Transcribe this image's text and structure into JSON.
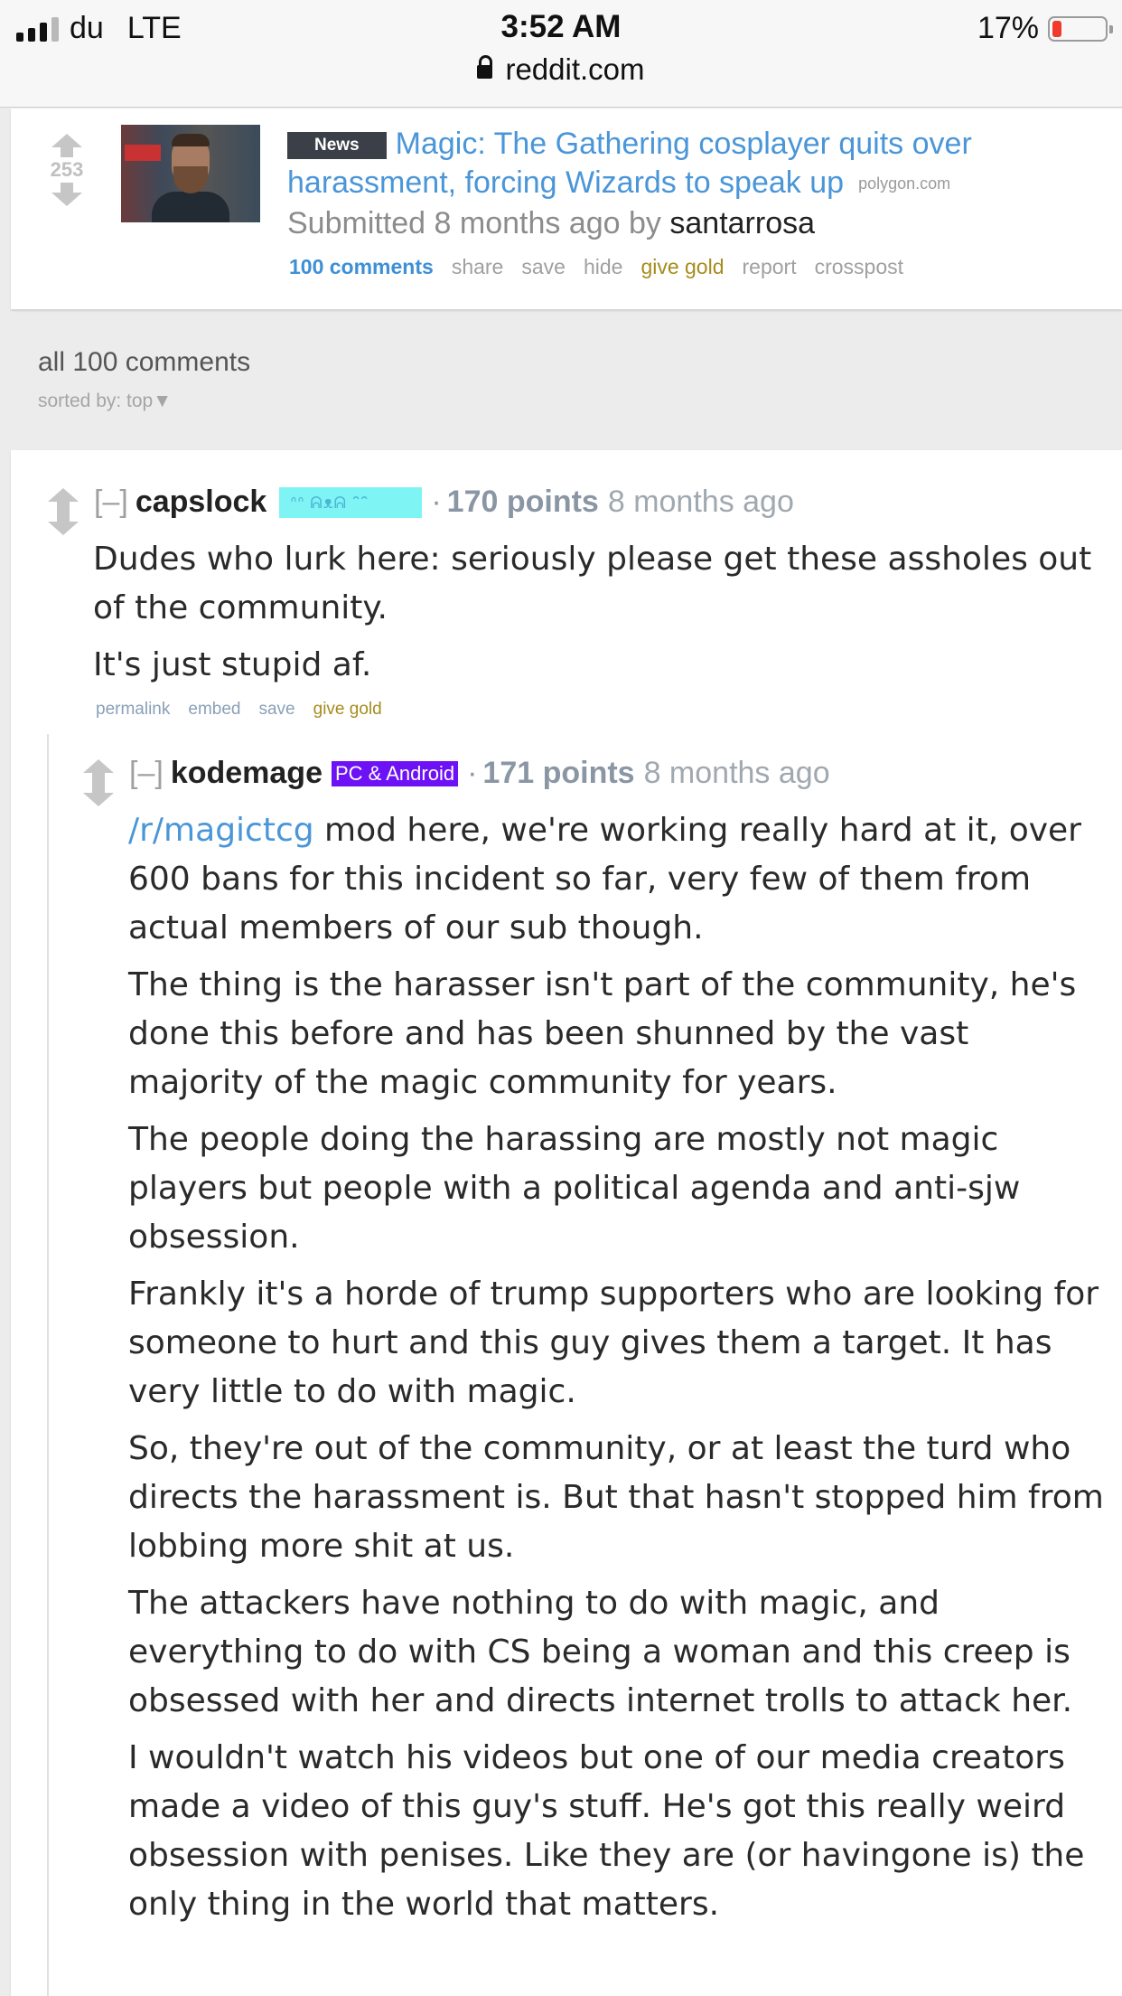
{
  "status_bar": {
    "carrier": "du",
    "network": "LTE",
    "time": "3:52 AM",
    "url": "reddit.com",
    "battery_percent": "17%",
    "battery_level": 0.17,
    "battery_color": "#f03a2e"
  },
  "post": {
    "score": "253",
    "flair": "News",
    "title": "Magic: The Gathering cosplayer quits over harassment, forcing Wizards to speak up",
    "domain": "polygon.com",
    "submitted_prefix": "Submitted 8 months ago by",
    "author": "santarrosa",
    "actions": {
      "comments": "100 comments",
      "share": "share",
      "save": "save",
      "hide": "hide",
      "give_gold": "give gold",
      "report": "report",
      "crosspost": "crosspost"
    }
  },
  "comments_header": {
    "all_comments": "all 100 comments",
    "sorted_by": "sorted by: top▼"
  },
  "comments": [
    {
      "collapse": "[–]",
      "username": "capslock",
      "flair": "ᐢᐢ ᕱᴥᕱ ᐢᐢ",
      "points": "170 points",
      "age": "8 months ago",
      "body": [
        "Dudes who lurk here: seriously please get these assholes out of the community.",
        "It's just stupid af."
      ],
      "actions": {
        "permalink": "permalink",
        "embed": "embed",
        "save": "save",
        "give_gold": "give gold"
      }
    },
    {
      "collapse": "[–]",
      "username": "kodemage",
      "flair": "PC & Android",
      "points": "171 points",
      "age": "8 months ago",
      "subreddit_link": "/r/magictcg",
      "body": [
        " mod here, we're working really hard at it, over 600 bans for this incident so far, very few of them from actual members of our sub though.",
        "The thing is the harasser isn't part of the community, he's done this before and has been shunned by the vast majority of the magic community for years.",
        "The people doing the harassing are mostly not magic players but people with a political agenda and anti-sjw obsession.",
        "Frankly it's a horde of trump supporters who are looking for someone to hurt and this guy gives them a target. It has very little to do with magic.",
        "So, they're out of the community, or at least the turd who directs the harassment is. But that hasn't stopped him from lobbing more shit at us.",
        "The attackers have nothing to do with magic, and everything to do with CS being a woman and this creep is obsessed with her and directs internet trolls to attack her.",
        "I wouldn't watch his videos but one of our media creators made a video of this guy's stuff. He's got this really weird obsession with penises. Like they are (or havingone is) the only thing in the world that matters."
      ]
    }
  ]
}
